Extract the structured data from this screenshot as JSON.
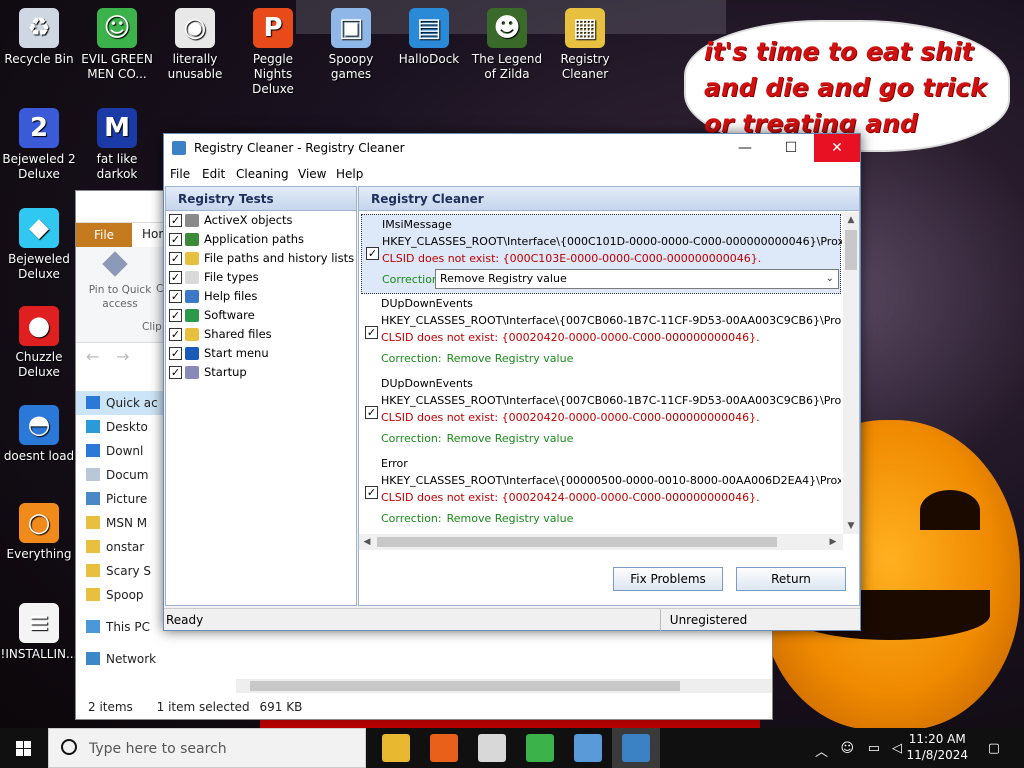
{
  "desktop": {
    "bubble_text": "it's time to eat shit and die and go trick or treating and vote!",
    "icons": [
      {
        "label": "Recycle Bin",
        "color": "#cfd8e2",
        "glyph": "♻"
      },
      {
        "label": "EVIL GREEN MEN CO...",
        "color": "#3bb34a",
        "glyph": "☺"
      },
      {
        "label": "literally unusable",
        "color": "#e8e8e8",
        "glyph": "◉"
      },
      {
        "label": "Peggle Nights Deluxe",
        "color": "#e84a1a",
        "glyph": "P"
      },
      {
        "label": "Spoopy games",
        "color": "#8fb8e8",
        "glyph": "▣"
      },
      {
        "label": "HalloDock",
        "color": "#2a8ad8",
        "glyph": "▤"
      },
      {
        "label": "The Legend of Zilda",
        "color": "#3a6a2a",
        "glyph": "☻"
      },
      {
        "label": "Registry Cleaner",
        "color": "#e8c040",
        "glyph": "▦"
      },
      {
        "label": "Bejeweled 2 Deluxe",
        "color": "#3a5ad8",
        "glyph": "2"
      },
      {
        "label": "fat like darkok",
        "color": "#1a3aa8",
        "glyph": "M"
      },
      {
        "label": "Bejeweled Deluxe",
        "color": "#30c8f0",
        "glyph": "◆"
      },
      {
        "label": "Chuzzle Deluxe",
        "color": "#e02020",
        "glyph": "●"
      },
      {
        "label": "doesnt load",
        "color": "#2a78d8",
        "glyph": "◓"
      },
      {
        "label": "Everything",
        "color": "#f08a1a",
        "glyph": "○"
      },
      {
        "label": "!INSTALLIN...",
        "color": "#f4f4f4",
        "glyph": "≡"
      }
    ]
  },
  "explorer": {
    "tab_file": "File",
    "tab_home": "Hom",
    "ribbon_pin": "Pin to Quick access",
    "ribbon_c": "C",
    "ribbon_clip": "Clip",
    "nav": [
      {
        "label": "Quick ac",
        "color": "#2a78d8"
      },
      {
        "label": "Deskto",
        "color": "#2a9ad8"
      },
      {
        "label": "Downl",
        "color": "#2a78d8"
      },
      {
        "label": "Docum",
        "color": "#b8c8d8"
      },
      {
        "label": "Picture",
        "color": "#4a88c8"
      },
      {
        "label": "MSN M",
        "color": "#e8c040"
      },
      {
        "label": "onstar",
        "color": "#e8c040"
      },
      {
        "label": "Scary S",
        "color": "#e8c040"
      },
      {
        "label": "Spoop",
        "color": "#e8c040"
      },
      {
        "label": "This PC",
        "color": "#4a98d8"
      },
      {
        "label": "Network",
        "color": "#3a88c8"
      }
    ],
    "status_items": "2 items",
    "status_selected": "1 item selected",
    "status_size": "691 KB"
  },
  "window": {
    "title": "Registry Cleaner - Registry Cleaner",
    "menu": [
      "File",
      "Edit",
      "Cleaning",
      "View",
      "Help"
    ],
    "left_header": "Registry Tests",
    "right_header": "Registry Cleaner",
    "tests": [
      {
        "label": "ActiveX objects",
        "checked": "✓",
        "color": "#8a8a8a"
      },
      {
        "label": "Application paths",
        "checked": "✓",
        "color": "#3a8a3a"
      },
      {
        "label": "File paths and history lists",
        "checked": "✓",
        "color": "#e8c040"
      },
      {
        "label": "File types",
        "checked": "✓",
        "color": "#d8d8d8"
      },
      {
        "label": "Help files",
        "checked": "✓",
        "color": "#3a78c8"
      },
      {
        "label": "Software",
        "checked": "✓",
        "color": "#2a9a4a"
      },
      {
        "label": "Shared files",
        "checked": "✓",
        "color": "#e8c040"
      },
      {
        "label": "Start menu",
        "checked": "✓",
        "color": "#1a5ab8"
      },
      {
        "label": "Startup",
        "checked": "✓",
        "color": "#8a8ab8"
      }
    ],
    "results": [
      {
        "name": "IMsiMessage",
        "key": "HKEY_CLASSES_ROOT\\Interface\\{000C101D-0000-0000-C000-000000000046}\\ProxyStubClsid",
        "error": "CLSID does not exist: {000C103E-0000-0000-C000-000000000046}.",
        "correction_label": "Correction:",
        "correction": "Remove Registry value",
        "checked": "✓"
      },
      {
        "name": "DUpDownEvents",
        "key": "HKEY_CLASSES_ROOT\\Interface\\{007CB060-1B7C-11CF-9D53-00AA003C9CB6}\\ProxyStubClsid",
        "error": "CLSID does not exist: {00020420-0000-0000-C000-000000000046}.",
        "correction_label": "Correction:",
        "correction": "Remove Registry value",
        "checked": "✓"
      },
      {
        "name": "DUpDownEvents",
        "key": "HKEY_CLASSES_ROOT\\Interface\\{007CB060-1B7C-11CF-9D53-00AA003C9CB6}\\ProxyStubClsid",
        "error": "CLSID does not exist: {00020420-0000-0000-C000-000000000046}.",
        "correction_label": "Correction:",
        "correction": "Remove Registry value",
        "checked": "✓"
      },
      {
        "name": "Error",
        "key": "HKEY_CLASSES_ROOT\\Interface\\{00000500-0000-0010-8000-00AA006D2EA4}\\ProxyStubClsid",
        "error": "CLSID does not exist: {00020424-0000-0000-C000-000000000046}.",
        "correction_label": "Correction:",
        "correction": "Remove Registry value",
        "checked": "✓"
      }
    ],
    "fix_button": "Fix Problems",
    "return_button": "Return",
    "status_ready": "Ready",
    "status_reg": "Unregistered"
  },
  "taskbar": {
    "search_placeholder": "Type here to search",
    "time": "11:20 AM",
    "date": "11/8/2024",
    "apps": [
      {
        "name": "file-explorer",
        "color": "#e8b830"
      },
      {
        "name": "firefox",
        "color": "#e8601a"
      },
      {
        "name": "notepad-app",
        "color": "#d8d8d8"
      },
      {
        "name": "msn-messenger",
        "color": "#3bb34a"
      },
      {
        "name": "system-app",
        "color": "#5a9ad8"
      },
      {
        "name": "registry-cleaner",
        "color": "#3b82c4"
      }
    ]
  }
}
